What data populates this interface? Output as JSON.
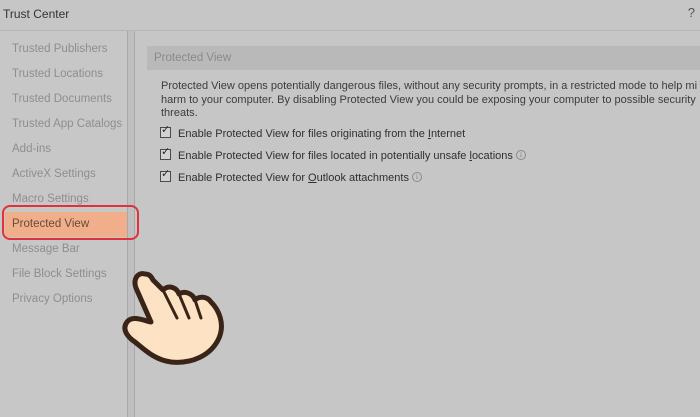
{
  "window": {
    "title": "Trust Center",
    "help_glyph": "?"
  },
  "sidebar": {
    "items": [
      {
        "label": "Trusted Publishers"
      },
      {
        "label": "Trusted Locations"
      },
      {
        "label": "Trusted Documents"
      },
      {
        "label": "Trusted App Catalogs"
      },
      {
        "label": "Add-ins"
      },
      {
        "label": "ActiveX Settings"
      },
      {
        "label": "Macro Settings"
      },
      {
        "label": "Protected View",
        "selected": true
      },
      {
        "label": "Message Bar"
      },
      {
        "label": "File Block Settings"
      },
      {
        "label": "Privacy Options"
      }
    ]
  },
  "main": {
    "section_title": "Protected View",
    "description": "Protected View opens potentially dangerous files, without any security prompts, in a restricted mode to help mi harm to your computer. By disabling Protected View you could be exposing your computer to possible security threats.",
    "options": [
      {
        "label_pre": "Enable Protected View for files originating from the ",
        "accel": "I",
        "label_post": "nternet",
        "checked": true,
        "info": false
      },
      {
        "label_pre": "Enable Protected View for files located in potentially unsafe ",
        "accel": "l",
        "label_post": "ocations",
        "checked": true,
        "info": true
      },
      {
        "label_pre": "Enable Protected View for ",
        "accel": "O",
        "label_post": "utlook attachments",
        "checked": true,
        "info": true
      }
    ]
  },
  "colors": {
    "background": "#c6c6c6",
    "selected_item": "#f0ae8b",
    "highlight_ring": "#e0323a",
    "hand_fill": "#fde2c4",
    "hand_outline": "#3a2418"
  },
  "icons": {
    "checkbox_mark": "✓",
    "info": "i",
    "pointer": "pointing-hand-icon"
  }
}
